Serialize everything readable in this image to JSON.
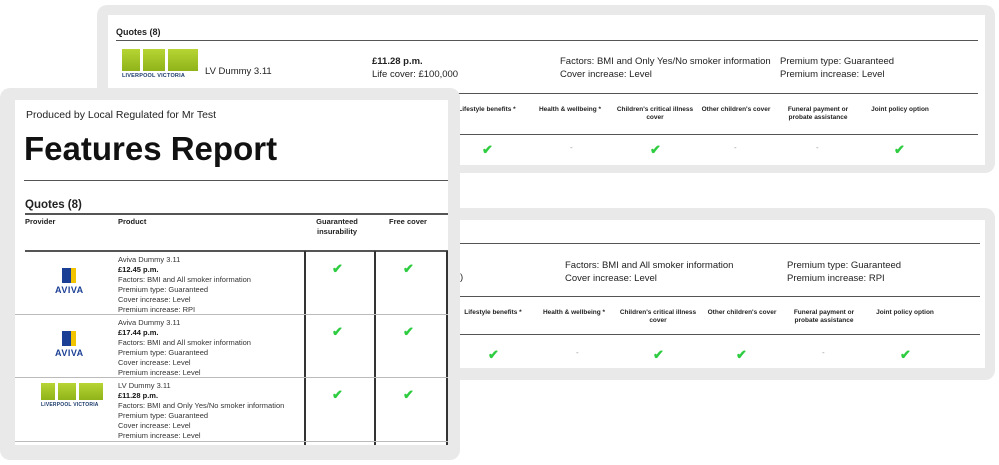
{
  "back_card_1": {
    "quotes_heading": "Quotes (8)",
    "provider_logo": "LIVERPOOL VICTORIA",
    "product": "LV Dummy 3.11",
    "price": "£11.28 p.m.",
    "life_cover": "Life cover: £100,000",
    "factors": "Factors: BMI and Only Yes/No smoker information",
    "cover_increase": "Cover increase: Level",
    "premium_type": "Premium type: Guaranteed",
    "premium_increase": "Premium increase: Level",
    "feature_headers": [
      "Lifestyle benefits *",
      "Health & wellbeing *",
      "Children's critical illness cover",
      "Other children's cover",
      "Funeral payment or probate assistance",
      "Joint policy option"
    ],
    "feature_values": [
      "check",
      "-",
      "check",
      "-",
      "-",
      "check"
    ]
  },
  "back_card_2": {
    "partial_text": ")",
    "factors": "Factors: BMI and All smoker information",
    "cover_increase": "Cover increase: Level",
    "premium_type": "Premium type: Guaranteed",
    "premium_increase": "Premium increase: RPI",
    "feature_headers": [
      "Lifestyle benefits *",
      "Health & wellbeing *",
      "Children's critical illness cover",
      "Other children's cover",
      "Funeral payment or probate assistance",
      "Joint policy option"
    ],
    "feature_values": [
      "check",
      "-",
      "check",
      "check",
      "-",
      "check"
    ]
  },
  "front": {
    "produced_by": "Produced by Local Regulated for Mr Test",
    "title": "Features Report",
    "quotes_heading": "Quotes (8)",
    "columns": [
      "Provider",
      "Product",
      "Guaranteed insurability",
      "Free cover"
    ],
    "rows": [
      {
        "provider": "AVIVA",
        "name": "Aviva Dummy 3.11",
        "price": "£12.45 p.m.",
        "factors": "Factors: BMI and All smoker information",
        "premium_type": "Premium type: Guaranteed",
        "cover_increase": "Cover increase: Level",
        "premium_increase": "Premium increase: RPI",
        "guaranteed_insurability": "check",
        "free_cover": "check"
      },
      {
        "provider": "AVIVA",
        "name": "Aviva Dummy 3.11",
        "price": "£17.44 p.m.",
        "factors": "Factors: BMI and All smoker information",
        "premium_type": "Premium type: Guaranteed",
        "cover_increase": "Cover increase: Level",
        "premium_increase": "Premium increase: Level",
        "guaranteed_insurability": "check",
        "free_cover": "check"
      },
      {
        "provider": "LIVERPOOL VICTORIA",
        "name": "LV Dummy 3.11",
        "price": "£11.28 p.m.",
        "factors": "Factors: BMI and Only Yes/No smoker information",
        "premium_type": "Premium type: Guaranteed",
        "cover_increase": "Cover increase: Level",
        "premium_increase": "Premium increase: Level",
        "guaranteed_insurability": "check",
        "free_cover": "check"
      }
    ]
  },
  "colors": {
    "check": "#2ecc40",
    "aviva_blue": "#1b3f95",
    "aviva_yellow": "#f2c400",
    "lv_green": "#a5c52a",
    "frame": "#e9e9e9"
  }
}
